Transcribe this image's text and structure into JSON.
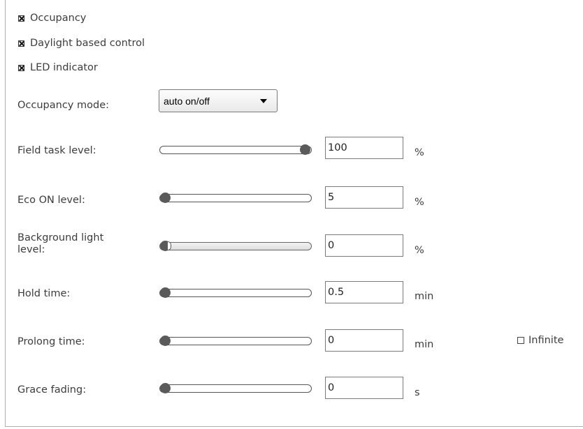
{
  "checkboxes": [
    {
      "label": "Occupancy",
      "checked": true
    },
    {
      "label": "Daylight based control",
      "checked": true
    },
    {
      "label": "LED indicator",
      "checked": true
    }
  ],
  "occupancy_mode": {
    "label": "Occupancy mode:",
    "value": "auto on/off"
  },
  "fields": {
    "field_task": {
      "label": "Field task level:",
      "value": "100",
      "unit": "%",
      "level": 1.0
    },
    "eco_on": {
      "label": "Eco ON level:",
      "value": "5",
      "unit": "%",
      "level": 0.0
    },
    "background": {
      "label_line1": "Background light",
      "label_line2": "level:",
      "value": "0",
      "unit": "%",
      "level": 0.0,
      "disabled": true
    },
    "hold_time": {
      "label": "Hold time:",
      "value": "0.5",
      "unit": "min",
      "level": 0.0
    },
    "prolong_time": {
      "label": "Prolong time:",
      "value": "0",
      "unit": "min",
      "level": 0.0
    },
    "grace_fading": {
      "label": "Grace fading:",
      "value": "0",
      "unit": "s",
      "level": 0.0
    }
  },
  "infinite": {
    "label": "Infinite",
    "checked": false
  }
}
